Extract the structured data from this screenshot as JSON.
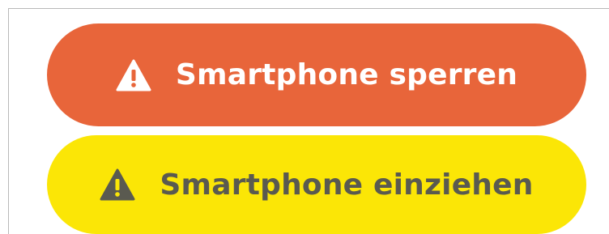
{
  "actions": {
    "lock": {
      "label": "Smartphone sperren",
      "icon": "warning-icon",
      "color": "#e8653a",
      "text_color": "#ffffff"
    },
    "confiscate": {
      "label": "Smartphone einziehen",
      "icon": "warning-icon",
      "color": "#fbe606",
      "text_color": "#5a5a50"
    }
  }
}
